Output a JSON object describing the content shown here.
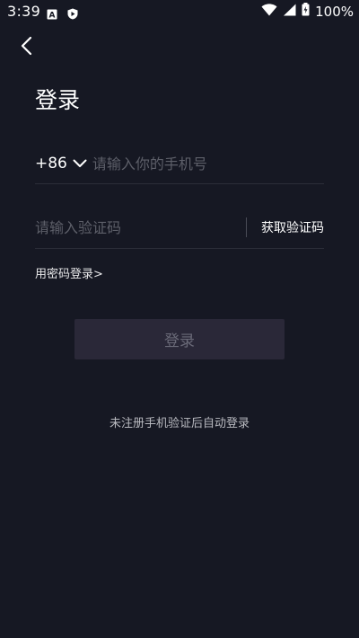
{
  "status_bar": {
    "time": "3:39",
    "battery": "100%",
    "icons": [
      "a-box-icon",
      "shield-play-icon",
      "wifi-icon",
      "signal-icon",
      "battery-charging-icon"
    ]
  },
  "header": {
    "back_icon": "chevron-left-icon"
  },
  "login": {
    "title": "登录",
    "country_code": "+86",
    "phone_placeholder": "请输入你的手机号",
    "code_placeholder": "请输入验证码",
    "get_code_label": "获取验证码",
    "password_login_link": "用密码登录>",
    "submit_label": "登录",
    "hint": "未注册手机验证后自动登录"
  },
  "colors": {
    "background": "#161823",
    "button_bg": "#2a2838",
    "button_text": "#6a6a78",
    "placeholder": "#5d5f69",
    "divider": "#2b2d38"
  }
}
